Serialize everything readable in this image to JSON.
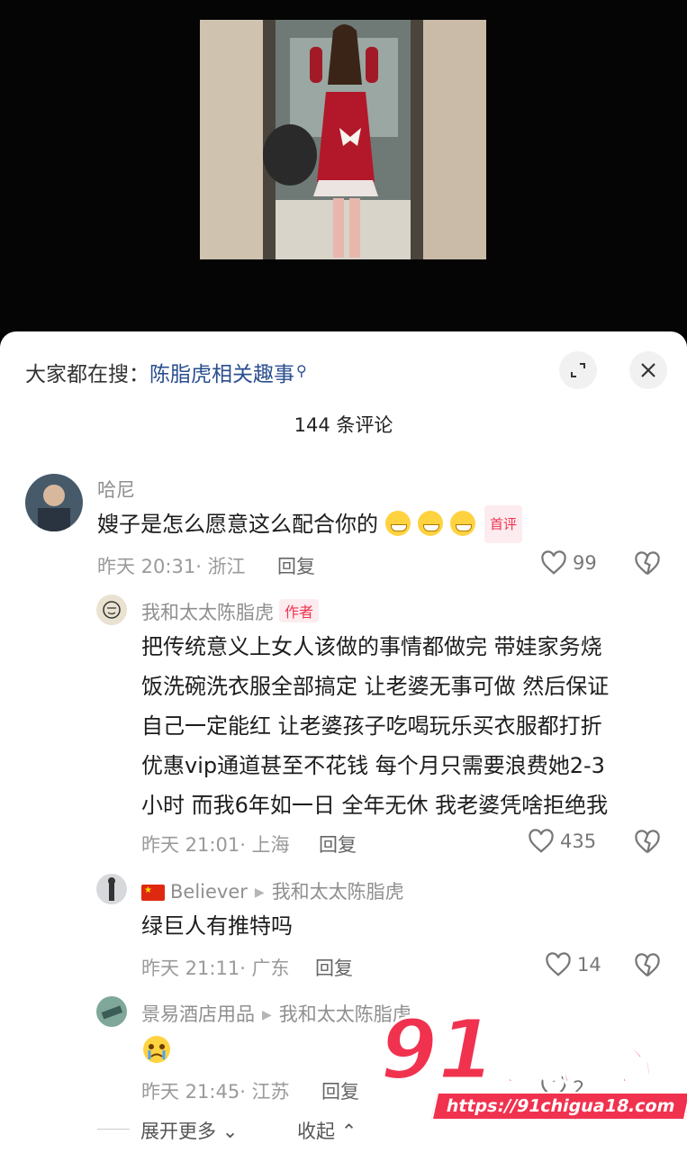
{
  "search": {
    "prefix": "大家都在搜：",
    "query": "陈脂虎相关趣事"
  },
  "comments_header": {
    "count": "144 条评论"
  },
  "comment1": {
    "username": "哈尼",
    "text": "嫂子是怎么愿意这么配合你的",
    "tag": "首评",
    "time_location": "昨天 20:31· 浙江",
    "reply_label": "回复",
    "likes": "99"
  },
  "reply1": {
    "username": "我和太太陈脂虎",
    "tag": "作者",
    "lines": [
      "把传统意义上女人该做的事情都做完 带娃家务烧",
      "饭洗碗洗衣服全部搞定 让老婆无事可做 然后保证",
      "自己一定能红 让老婆孩子吃喝玩乐买衣服都打折",
      "优惠vip通道甚至不花钱 每个月只需要浪费她2-3",
      "小时 而我6年如一日 全年无休 我老婆凭啥拒绝我"
    ],
    "time_location": "昨天 21:01· 上海",
    "reply_label": "回复",
    "likes": "435"
  },
  "reply2": {
    "username": "Believer",
    "reply_to": "我和太太陈脂虎",
    "text": "绿巨人有推特吗",
    "time_location": "昨天 21:11· 广东",
    "reply_label": "回复",
    "likes": "14"
  },
  "reply3": {
    "username": "景易酒店用品",
    "reply_to": "我和太太陈脂虎",
    "time_location": "昨天 21:45· 江苏",
    "reply_label": "回复",
    "likes": "2"
  },
  "footer": {
    "expand": "展开更多",
    "collapse": "收起"
  },
  "watermark": {
    "logo": "91吃瓜中心",
    "url": "https://91chigua18.com"
  },
  "colors": {
    "accent_pink": "#f0324f",
    "link_blue": "#2a4e8f"
  }
}
